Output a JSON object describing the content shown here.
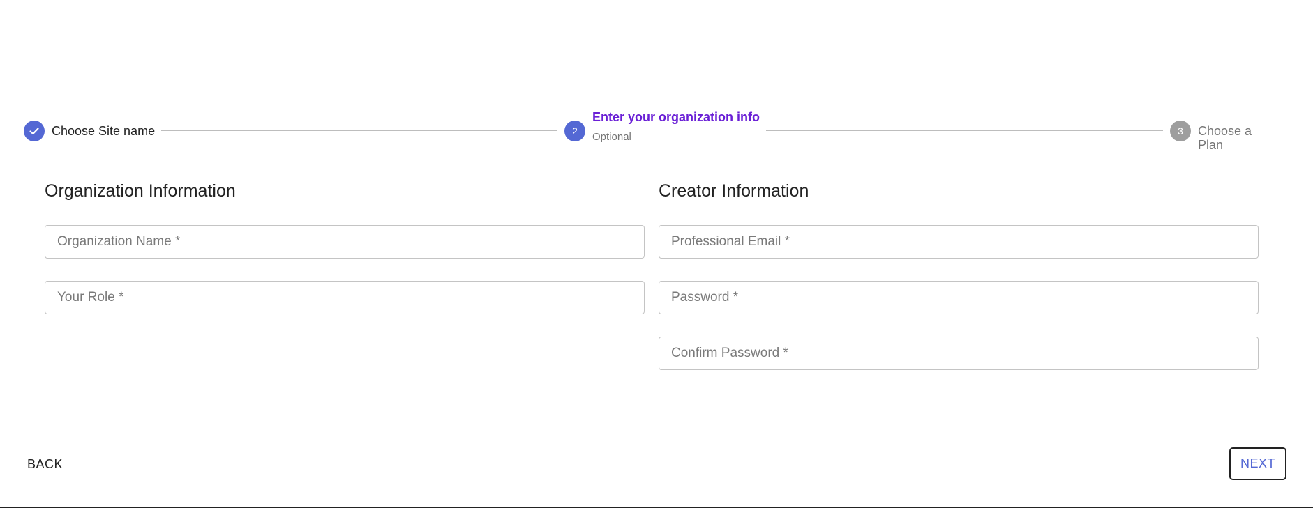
{
  "stepper": {
    "steps": [
      {
        "number": "1",
        "label": "Choose Site name",
        "status": "done",
        "icon": "check-icon"
      },
      {
        "number": "2",
        "label": "Enter your organization info",
        "subtitle": "Optional",
        "status": "active"
      },
      {
        "number": "3",
        "label": "Choose a Plan",
        "status": "pending"
      }
    ],
    "colors": {
      "active": "#5468d4",
      "active_label": "#6a1fd6",
      "pending": "#9e9e9e"
    }
  },
  "organization": {
    "title": "Organization Information",
    "fields": [
      {
        "placeholder": "Organization Name *",
        "value": ""
      },
      {
        "placeholder": "Your Role *",
        "value": ""
      }
    ]
  },
  "creator": {
    "title": "Creator Information",
    "fields": [
      {
        "placeholder": "Professional Email *",
        "value": ""
      },
      {
        "placeholder": "Password *",
        "value": ""
      },
      {
        "placeholder": "Confirm Password *",
        "value": ""
      }
    ]
  },
  "actions": {
    "back_label": "BACK",
    "next_label": "NEXT"
  }
}
